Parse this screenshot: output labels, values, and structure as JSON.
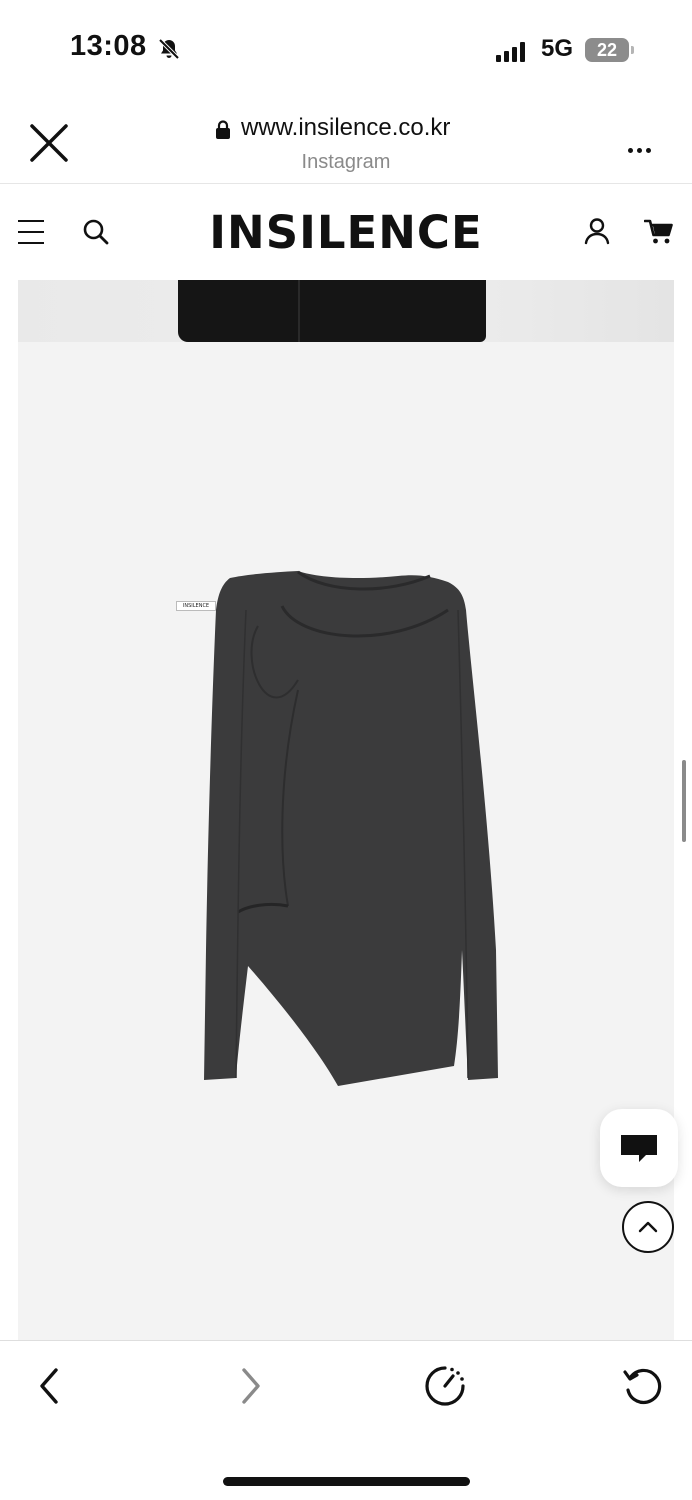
{
  "status_bar": {
    "time": "13:08",
    "network": "5G",
    "battery_level": "22",
    "icons": [
      "bell-slash-icon",
      "signal-icon",
      "battery-icon"
    ]
  },
  "browser": {
    "url": "www.insilence.co.kr",
    "subtitle": "Instagram",
    "icons": [
      "close-icon",
      "lock-icon",
      "more-icon"
    ]
  },
  "site_header": {
    "brand": "INSILENCE",
    "icons": [
      "menu-icon",
      "search-icon",
      "user-icon",
      "cart-icon"
    ]
  },
  "product": {
    "tag_text": "INSILENCE",
    "garment_color": "#3b3b3c",
    "background_color": "#f3f3f3"
  },
  "floating": {
    "icons": [
      "chat-icon",
      "chevron-up-icon"
    ]
  },
  "bottom_bar": {
    "icons": [
      "chevron-left-icon",
      "chevron-right-icon",
      "speed-icon",
      "reload-icon"
    ]
  }
}
